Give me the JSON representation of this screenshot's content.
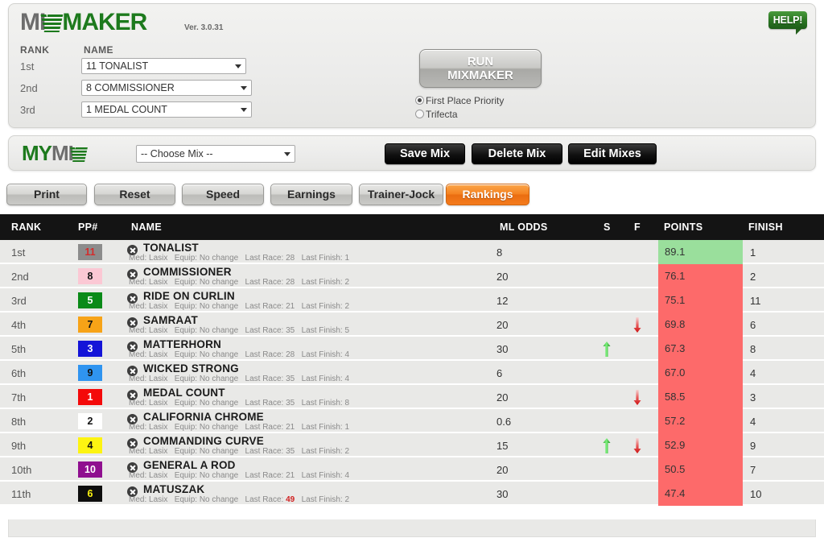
{
  "app": {
    "logo_part1": "MI",
    "logo_part2": "MAKER",
    "version": "Ver. 3.0.31",
    "help_label": "HELP!"
  },
  "mixmaker": {
    "col_rank_label": "RANK",
    "col_name_label": "NAME",
    "picks": [
      {
        "rank": "1st",
        "value": "11  TONALIST"
      },
      {
        "rank": "2nd",
        "value": "8  COMMISSIONER"
      },
      {
        "rank": "3rd",
        "value": "1  MEDAL COUNT"
      }
    ],
    "run_button_line1": "RUN",
    "run_button_line2": "MIXMAKER",
    "mode_options": [
      {
        "label": "First Place Priority",
        "selected": true
      },
      {
        "label": "Trifecta",
        "selected": false
      }
    ]
  },
  "mymix": {
    "logo_part1": "MY",
    "logo_part2": "MI",
    "select_value": "-- Choose Mix --",
    "save_label": "Save Mix",
    "delete_label": "Delete Mix",
    "edit_label": "Edit Mixes"
  },
  "tabs": [
    {
      "label": "Print",
      "active": false
    },
    {
      "label": "Reset",
      "active": false
    },
    {
      "label": "Speed",
      "active": false
    },
    {
      "label": "Earnings",
      "active": false
    },
    {
      "label": "Trainer-Jock",
      "active": false
    },
    {
      "label": "Rankings",
      "active": true
    }
  ],
  "table": {
    "headers": {
      "rank": "RANK",
      "pp": "PP#",
      "name": "NAME",
      "ml_odds": "ML ODDS",
      "s": "S",
      "f": "F",
      "points": "POINTS",
      "finish": "FINISH"
    },
    "sub_prefix": {
      "med": "Med:",
      "equip": "Equip:",
      "last_race": "Last Race:",
      "last_finish": "Last Finish:"
    },
    "rows": [
      {
        "rank": "1st",
        "pp": "11",
        "pp_bg": "#8c8c8c",
        "pp_fg": "#d42b2b",
        "name": "TONALIST",
        "med": "Lasix",
        "equip": "No change",
        "last_race": "28",
        "last_race_hot": false,
        "last_finish": "1",
        "ml_odds": "8",
        "s_arrow": false,
        "f_arrow": false,
        "points": "89.1",
        "points_state": "good",
        "finish": "1"
      },
      {
        "rank": "2nd",
        "pp": "8",
        "pp_bg": "#fbc8d4",
        "pp_fg": "#111111",
        "name": "COMMISSIONER",
        "med": "Lasix",
        "equip": "No change",
        "last_race": "28",
        "last_race_hot": false,
        "last_finish": "2",
        "ml_odds": "20",
        "s_arrow": false,
        "f_arrow": false,
        "points": "76.1",
        "points_state": "bad",
        "finish": "2"
      },
      {
        "rank": "3rd",
        "pp": "5",
        "pp_bg": "#0a8a18",
        "pp_fg": "#ffffff",
        "name": "RIDE ON CURLIN",
        "med": "Lasix",
        "equip": "No change",
        "last_race": "21",
        "last_race_hot": false,
        "last_finish": "2",
        "ml_odds": "12",
        "s_arrow": false,
        "f_arrow": false,
        "points": "75.1",
        "points_state": "bad",
        "finish": "11"
      },
      {
        "rank": "4th",
        "pp": "7",
        "pp_bg": "#f7a317",
        "pp_fg": "#111111",
        "name": "SAMRAAT",
        "med": "Lasix",
        "equip": "No change",
        "last_race": "35",
        "last_race_hot": false,
        "last_finish": "5",
        "ml_odds": "20",
        "s_arrow": false,
        "f_arrow": true,
        "points": "69.8",
        "points_state": "bad",
        "finish": "6"
      },
      {
        "rank": "5th",
        "pp": "3",
        "pp_bg": "#1414d8",
        "pp_fg": "#ffffff",
        "name": "MATTERHORN",
        "med": "Lasix",
        "equip": "No change",
        "last_race": "28",
        "last_race_hot": false,
        "last_finish": "4",
        "ml_odds": "30",
        "s_arrow": true,
        "f_arrow": false,
        "points": "67.3",
        "points_state": "bad",
        "finish": "8"
      },
      {
        "rank": "6th",
        "pp": "9",
        "pp_bg": "#2f94f0",
        "pp_fg": "#111111",
        "name": "WICKED STRONG",
        "med": "Lasix",
        "equip": "No change",
        "last_race": "35",
        "last_race_hot": false,
        "last_finish": "4",
        "ml_odds": "6",
        "s_arrow": false,
        "f_arrow": false,
        "points": "67.0",
        "points_state": "bad",
        "finish": "4"
      },
      {
        "rank": "7th",
        "pp": "1",
        "pp_bg": "#f40a0a",
        "pp_fg": "#ffffff",
        "name": "MEDAL COUNT",
        "med": "Lasix",
        "equip": "No change",
        "last_race": "35",
        "last_race_hot": false,
        "last_finish": "8",
        "ml_odds": "20",
        "s_arrow": false,
        "f_arrow": true,
        "points": "58.5",
        "points_state": "bad",
        "finish": "3"
      },
      {
        "rank": "8th",
        "pp": "2",
        "pp_bg": "#ffffff",
        "pp_fg": "#111111",
        "name": "CALIFORNIA CHROME",
        "med": "Lasix",
        "equip": "No change",
        "last_race": "21",
        "last_race_hot": false,
        "last_finish": "1",
        "ml_odds": "0.6",
        "s_arrow": false,
        "f_arrow": false,
        "points": "57.2",
        "points_state": "bad",
        "finish": "4"
      },
      {
        "rank": "9th",
        "pp": "4",
        "pp_bg": "#fdf411",
        "pp_fg": "#111111",
        "name": "COMMANDING CURVE",
        "med": "Lasix",
        "equip": "No change",
        "last_race": "35",
        "last_race_hot": false,
        "last_finish": "2",
        "ml_odds": "15",
        "s_arrow": true,
        "f_arrow": true,
        "points": "52.9",
        "points_state": "bad",
        "finish": "9"
      },
      {
        "rank": "10th",
        "pp": "10",
        "pp_bg": "#8f0f8f",
        "pp_fg": "#ffffff",
        "name": "GENERAL A ROD",
        "med": "Lasix",
        "equip": "No change",
        "last_race": "21",
        "last_race_hot": false,
        "last_finish": "4",
        "ml_odds": "20",
        "s_arrow": false,
        "f_arrow": false,
        "points": "50.5",
        "points_state": "bad",
        "finish": "7"
      },
      {
        "rank": "11th",
        "pp": "6",
        "pp_bg": "#0d0d0d",
        "pp_fg": "#fdf411",
        "name": "MATUSZAK",
        "med": "Lasix",
        "equip": "No change",
        "last_race": "49",
        "last_race_hot": true,
        "last_finish": "2",
        "ml_odds": "30",
        "s_arrow": false,
        "f_arrow": false,
        "points": "47.4",
        "points_state": "bad",
        "finish": "10"
      }
    ]
  },
  "colors": {
    "accent_orange": "#f58220",
    "brand_green": "#1d7a1d",
    "points_good": "#9adf9c",
    "points_bad": "#fd6a6a",
    "header_black": "#141414"
  }
}
